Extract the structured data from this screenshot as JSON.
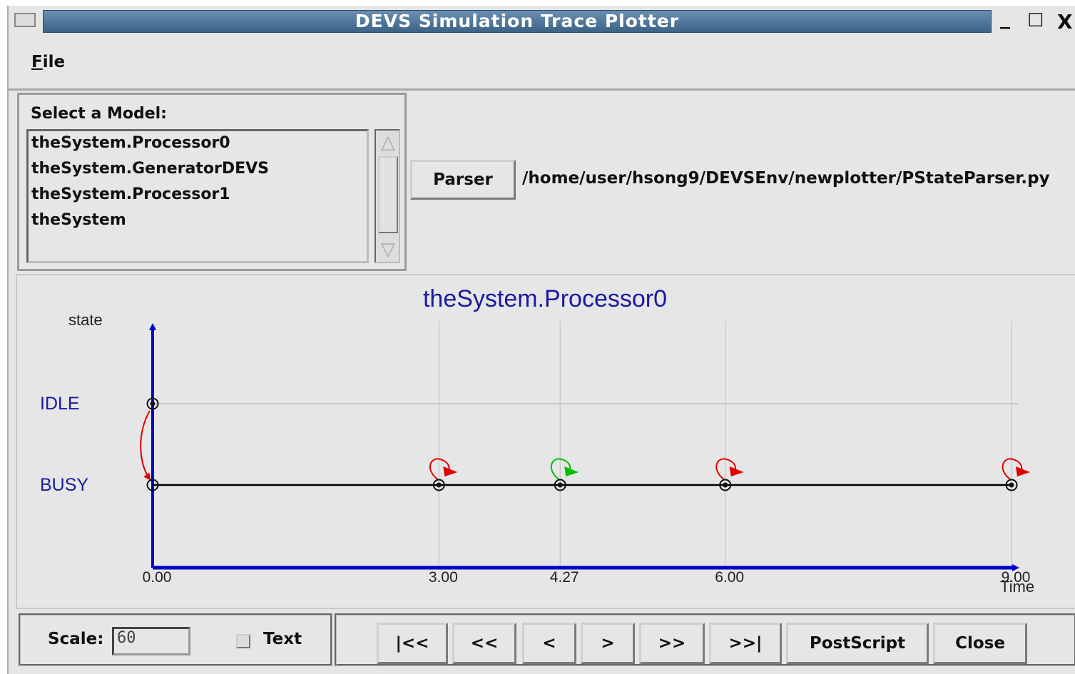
{
  "window": {
    "title": "DEVS Simulation Trace Plotter",
    "minimize": "_",
    "maximize": "☐",
    "close": "X"
  },
  "menu": {
    "file": "File"
  },
  "model_panel": {
    "label": "Select a Model:",
    "models": [
      "theSystem.Processor0",
      "theSystem.GeneratorDEVS",
      "theSystem.Processor1",
      "theSystem"
    ]
  },
  "parser": {
    "button": "Parser",
    "path": "/home/user/hsong9/DEVSEnv/newplotter/PStateParser.py"
  },
  "chart_data": {
    "type": "scatter",
    "title": "theSystem.Processor0",
    "ylabel": "state",
    "xlabel": "Time",
    "states": [
      "IDLE",
      "BUSY"
    ],
    "x_ticks": [
      "0.00",
      "3.00",
      "4.27",
      "6.00",
      "9.00"
    ],
    "x": [
      0.0,
      3.0,
      4.27,
      6.0,
      9.0
    ],
    "xlim": [
      0,
      9
    ],
    "grid": true,
    "transitions": [
      {
        "from_time": 0.0,
        "from_state": "IDLE",
        "to_state": "BUSY",
        "kind": "external",
        "color": "#e00000"
      }
    ],
    "self_transitions": [
      {
        "time": 3.0,
        "state": "BUSY",
        "color": "#e00000"
      },
      {
        "time": 4.27,
        "state": "BUSY",
        "color": "#00c000"
      },
      {
        "time": 6.0,
        "state": "BUSY",
        "color": "#e00000"
      },
      {
        "time": 9.0,
        "state": "BUSY",
        "color": "#e00000"
      }
    ],
    "timeline_state": "BUSY",
    "colors": {
      "axis": "#0000cc",
      "title": "#1a1aa0",
      "state_label": "#1a1aa0",
      "grid": "#bdbdbd",
      "line": "#000000"
    }
  },
  "controls": {
    "scale_label": "Scale:",
    "scale_value": "60",
    "text_label": "Text",
    "buttons": [
      "|<<",
      "<<",
      "<",
      ">",
      ">>",
      ">>|",
      "PostScript",
      "Close"
    ]
  }
}
